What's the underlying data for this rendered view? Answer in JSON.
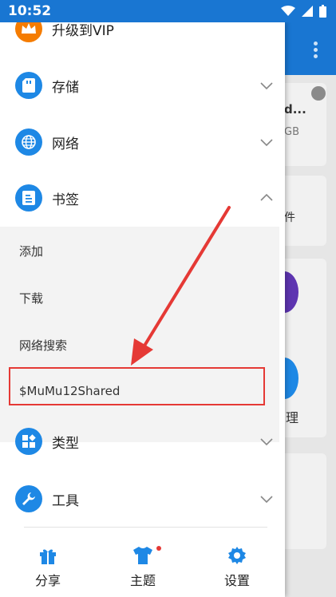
{
  "status_bar": {
    "time": "10:52"
  },
  "drawer": {
    "menu": [
      {
        "key": "vip",
        "label": "升级到VIP",
        "icon": "crown-icon",
        "expanded": null
      },
      {
        "key": "storage",
        "label": "存储",
        "icon": "sd-card-icon",
        "expanded": false
      },
      {
        "key": "network",
        "label": "网络",
        "icon": "globe-icon",
        "expanded": false
      },
      {
        "key": "bookmarks",
        "label": "书签",
        "icon": "bookmark-icon",
        "expanded": true
      },
      {
        "key": "types",
        "label": "类型",
        "icon": "category-icon",
        "expanded": false
      },
      {
        "key": "tools",
        "label": "工具",
        "icon": "wrench-icon",
        "expanded": false
      }
    ],
    "bookmarks_sub": [
      "添加",
      "下载",
      "网络搜索",
      "$MuMu12Shared"
    ]
  },
  "bottom_bar": {
    "items": [
      {
        "label": "分享",
        "icon": "gift-icon"
      },
      {
        "label": "主题",
        "icon": "tshirt-icon",
        "badge": true
      },
      {
        "label": "设置",
        "icon": "gear-icon"
      }
    ]
  },
  "background": {
    "card1_title": "d...",
    "card1_sub": "GB",
    "card2_text": "件",
    "item_text": "理"
  },
  "colors": {
    "primary": "#1e88e5",
    "statusbar": "#1976d2",
    "vip": "#f57c00",
    "annotation": "#e53935"
  }
}
